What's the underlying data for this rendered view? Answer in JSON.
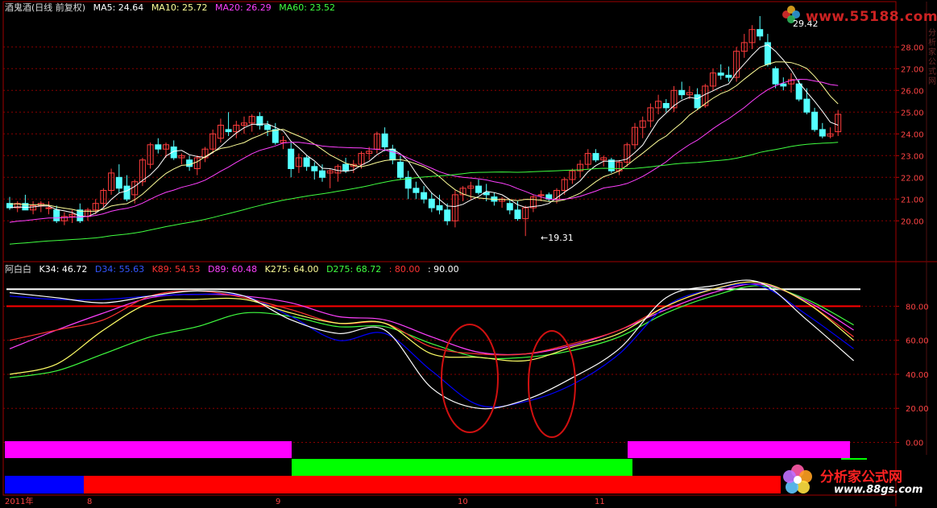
{
  "main_header": {
    "title": "酒鬼酒(日线 前复权)",
    "ma5": "MA5: 24.64",
    "ma10": "MA10: 25.72",
    "ma20": "MA20: 26.29",
    "ma60": "MA60: 23.52"
  },
  "sub_header": {
    "name": "阿白白",
    "k34": "K34: 46.72",
    "d34": "D34: 55.63",
    "k89": "K89: 54.53",
    "d89": "D89: 60.48",
    "k275": "K275: 64.00",
    "d275": "D275: 68.72",
    "l80": ": 80.00",
    "l90": ": 90.00"
  },
  "annotations": {
    "high": "29.42",
    "low": "←19.31"
  },
  "x_axis_labels": [
    "2011年",
    "8",
    "9",
    "10",
    "11"
  ],
  "watermarks": {
    "top": "www.55188.com",
    "bottom_title": "分析家公式网",
    "bottom_url": "www.88gs.com"
  },
  "right_strip_text": "分析家公式网",
  "colors": {
    "bg": "#000000",
    "up": "#ff3c3c",
    "down": "#54ffff",
    "grid": "#8b0000",
    "ma5": "#ffffff",
    "ma10": "#ffff99",
    "ma20": "#ff40ff",
    "ma60": "#40ff40",
    "bar_magenta": "#ff00ff",
    "bar_green": "#00ff00",
    "bar_blue": "#0000ff",
    "bar_red": "#ff0000"
  },
  "chart_data": [
    {
      "type": "candlestick",
      "title": "酒鬼酒(日线 前复权)",
      "y_ticks": [
        20.0,
        21.0,
        22.0,
        23.0,
        24.0,
        25.0,
        26.0,
        27.0,
        28.0
      ],
      "ylim": [
        19.0,
        29.8
      ],
      "candles": [
        [
          20.8,
          21.1,
          20.5,
          20.6
        ],
        [
          20.6,
          20.9,
          20.4,
          20.8
        ],
        [
          20.8,
          21.2,
          20.6,
          20.5
        ],
        [
          20.5,
          20.9,
          20.3,
          20.7
        ],
        [
          20.7,
          20.9,
          20.4,
          20.8
        ],
        [
          20.6,
          20.9,
          20.3,
          20.6
        ],
        [
          20.5,
          20.7,
          19.9,
          20.0
        ],
        [
          20.0,
          20.4,
          19.8,
          20.2
        ],
        [
          20.2,
          20.5,
          19.9,
          20.3
        ],
        [
          20.5,
          20.8,
          19.9,
          20.0
        ],
        [
          20.2,
          20.6,
          20.0,
          20.5
        ],
        [
          20.5,
          21.0,
          20.3,
          20.8
        ],
        [
          20.8,
          21.5,
          20.6,
          21.4
        ],
        [
          21.4,
          22.4,
          21.2,
          22.2
        ],
        [
          22.0,
          22.6,
          21.3,
          21.5
        ],
        [
          21.6,
          22.1,
          20.9,
          21.0
        ],
        [
          21.2,
          21.9,
          20.8,
          21.8
        ],
        [
          21.8,
          22.9,
          21.6,
          22.8
        ],
        [
          22.6,
          23.6,
          22.4,
          23.5
        ],
        [
          23.5,
          23.8,
          23.1,
          23.3
        ],
        [
          23.3,
          23.6,
          22.9,
          23.5
        ],
        [
          23.4,
          23.7,
          22.8,
          22.9
        ],
        [
          22.9,
          23.1,
          22.6,
          23.0
        ],
        [
          22.8,
          23.0,
          22.3,
          22.5
        ],
        [
          22.4,
          23.0,
          22.1,
          22.9
        ],
        [
          22.9,
          23.4,
          22.7,
          23.3
        ],
        [
          23.3,
          24.2,
          23.1,
          24.0
        ],
        [
          23.8,
          24.7,
          23.6,
          24.4
        ],
        [
          24.2,
          25.0,
          23.9,
          24.1
        ],
        [
          24.1,
          24.6,
          23.8,
          24.4
        ],
        [
          24.4,
          24.8,
          24.0,
          24.5
        ],
        [
          24.5,
          24.9,
          24.1,
          24.8
        ],
        [
          24.8,
          25.0,
          24.2,
          24.4
        ],
        [
          24.4,
          24.6,
          23.9,
          24.2
        ],
        [
          24.2,
          24.5,
          23.5,
          23.6
        ],
        [
          23.6,
          23.9,
          23.3,
          23.7
        ],
        [
          23.3,
          23.6,
          22.0,
          22.4
        ],
        [
          22.5,
          23.1,
          22.2,
          22.9
        ],
        [
          22.9,
          23.0,
          22.3,
          22.5
        ],
        [
          22.5,
          22.7,
          21.9,
          22.3
        ],
        [
          22.3,
          22.6,
          21.8,
          22.0
        ],
        [
          22.2,
          22.4,
          21.5,
          22.3
        ],
        [
          22.2,
          22.6,
          21.8,
          22.5
        ],
        [
          22.6,
          22.9,
          22.2,
          22.3
        ],
        [
          22.5,
          22.8,
          22.2,
          22.6
        ],
        [
          22.6,
          23.2,
          22.4,
          23.1
        ],
        [
          23.1,
          23.4,
          22.8,
          23.2
        ],
        [
          23.3,
          24.1,
          23.1,
          24.0
        ],
        [
          24.0,
          24.3,
          23.2,
          23.4
        ],
        [
          23.3,
          23.5,
          22.6,
          22.8
        ],
        [
          22.7,
          23.0,
          21.9,
          22.0
        ],
        [
          22.0,
          22.3,
          21.0,
          21.5
        ],
        [
          21.5,
          21.8,
          21.0,
          21.3
        ],
        [
          21.3,
          21.6,
          20.8,
          21.0
        ],
        [
          21.0,
          21.3,
          20.4,
          20.6
        ],
        [
          20.7,
          21.2,
          20.3,
          20.5
        ],
        [
          20.5,
          20.8,
          19.8,
          20.0
        ],
        [
          20.0,
          21.4,
          19.7,
          21.2
        ],
        [
          21.2,
          21.6,
          20.9,
          21.5
        ],
        [
          21.5,
          21.8,
          21.0,
          21.6
        ],
        [
          21.6,
          21.9,
          21.2,
          21.3
        ],
        [
          21.3,
          21.7,
          20.9,
          21.2
        ],
        [
          21.1,
          21.3,
          20.7,
          20.9
        ],
        [
          20.9,
          21.1,
          20.6,
          21.0
        ],
        [
          20.8,
          21.0,
          20.3,
          20.5
        ],
        [
          20.5,
          20.9,
          20.0,
          20.1
        ],
        [
          20.1,
          20.7,
          19.3,
          20.6
        ],
        [
          20.6,
          21.2,
          20.4,
          21.1
        ],
        [
          21.2,
          21.4,
          20.9,
          21.2
        ],
        [
          21.2,
          21.3,
          20.9,
          21.0
        ],
        [
          21.0,
          21.5,
          20.8,
          21.4
        ],
        [
          21.4,
          22.0,
          21.2,
          21.9
        ],
        [
          21.9,
          22.4,
          21.7,
          22.3
        ],
        [
          22.3,
          22.8,
          22.0,
          22.6
        ],
        [
          22.6,
          23.3,
          22.4,
          23.1
        ],
        [
          23.1,
          23.3,
          22.7,
          22.8
        ],
        [
          22.8,
          23.0,
          22.5,
          22.9
        ],
        [
          22.8,
          22.9,
          22.2,
          22.3
        ],
        [
          22.3,
          22.8,
          22.1,
          22.7
        ],
        [
          22.7,
          23.6,
          22.5,
          23.5
        ],
        [
          23.5,
          24.5,
          23.3,
          24.3
        ],
        [
          24.3,
          24.8,
          23.8,
          24.6
        ],
        [
          24.6,
          25.4,
          24.3,
          25.2
        ],
        [
          25.2,
          25.8,
          24.9,
          25.5
        ],
        [
          25.4,
          25.6,
          25.0,
          25.2
        ],
        [
          25.2,
          26.2,
          25.0,
          26.0
        ],
        [
          26.0,
          26.4,
          25.6,
          25.8
        ],
        [
          25.8,
          26.2,
          25.6,
          25.9
        ],
        [
          25.8,
          26.1,
          25.1,
          25.2
        ],
        [
          25.3,
          26.3,
          25.2,
          26.2
        ],
        [
          26.2,
          27.0,
          26.0,
          26.8
        ],
        [
          26.8,
          27.2,
          26.5,
          26.7
        ],
        [
          26.7,
          27.1,
          26.4,
          26.6
        ],
        [
          26.6,
          28.0,
          26.4,
          27.8
        ],
        [
          27.8,
          28.6,
          27.5,
          28.2
        ],
        [
          28.2,
          29.0,
          27.9,
          28.8
        ],
        [
          28.8,
          29.42,
          28.3,
          28.5
        ],
        [
          28.2,
          28.6,
          27.1,
          27.2
        ],
        [
          27.0,
          27.1,
          26.1,
          26.3
        ],
        [
          26.3,
          26.6,
          26.0,
          26.2
        ],
        [
          26.3,
          26.8,
          25.9,
          26.5
        ],
        [
          26.3,
          26.5,
          25.5,
          25.6
        ],
        [
          25.6,
          26.1,
          24.9,
          25.0
        ],
        [
          25.0,
          25.2,
          24.1,
          24.2
        ],
        [
          24.2,
          24.5,
          23.8,
          23.9
        ],
        [
          23.9,
          24.3,
          23.8,
          24.0
        ],
        [
          24.1,
          25.1,
          23.9,
          24.9
        ]
      ]
    },
    {
      "type": "line",
      "title": "阿白白",
      "y_ticks": [
        0,
        20,
        40,
        60,
        80
      ],
      "ylim": [
        -5,
        102
      ],
      "reference_lines": [
        {
          "name": "80.00",
          "value": 80,
          "color": "#ff0000"
        },
        {
          "name": "90.00",
          "value": 90,
          "color": "#ffffff"
        }
      ],
      "x_index": [
        0,
        6,
        12,
        18,
        24,
        30,
        36,
        42,
        48,
        54,
        60,
        66,
        72,
        78,
        84,
        90,
        96,
        102,
        108
      ],
      "series": [
        {
          "name": "K34",
          "color": "#ffffff",
          "values": [
            88,
            85,
            82,
            86,
            89,
            86,
            72,
            64,
            66,
            32,
            20,
            25,
            38,
            55,
            85,
            92,
            94,
            72,
            48
          ]
        },
        {
          "name": "D34",
          "color": "#0000ff",
          "values": [
            86,
            84,
            84,
            86,
            87,
            86,
            74,
            60,
            64,
            42,
            22,
            24,
            34,
            52,
            80,
            90,
            92,
            75,
            55
          ]
        },
        {
          "name": "K89",
          "color": "#ff3333",
          "values": [
            60,
            66,
            72,
            86,
            89,
            85,
            78,
            70,
            70,
            56,
            52,
            52,
            58,
            66,
            80,
            90,
            94,
            82,
            62
          ]
        },
        {
          "name": "D89",
          "color": "#ff40ff",
          "values": [
            55,
            66,
            76,
            85,
            87,
            86,
            82,
            74,
            72,
            62,
            53,
            52,
            57,
            66,
            78,
            88,
            93,
            83,
            66
          ]
        },
        {
          "name": "K275",
          "color": "#ffff66",
          "values": [
            40,
            46,
            66,
            82,
            84,
            84,
            76,
            70,
            70,
            52,
            50,
            48,
            56,
            64,
            80,
            90,
            94,
            82,
            60
          ]
        },
        {
          "name": "D275",
          "color": "#40ff40",
          "values": [
            38,
            42,
            52,
            62,
            68,
            76,
            74,
            68,
            68,
            58,
            50,
            50,
            54,
            62,
            76,
            86,
            92,
            84,
            69
          ]
        }
      ]
    }
  ],
  "color_bars": [
    {
      "name": "bar-row1-magenta-a",
      "color": "#ff00ff",
      "row": 1,
      "from": 0,
      "to": 58
    },
    {
      "name": "bar-row1-magenta-b",
      "color": "#ff00ff",
      "row": 1,
      "from": 126,
      "to": 171
    },
    {
      "name": "bar-row2-green",
      "color": "#00ff00",
      "row": 2,
      "from": 58,
      "to": 127
    },
    {
      "name": "bar-row3-blue",
      "color": "#0000ff",
      "row": 3,
      "from": 0,
      "to": 16
    },
    {
      "name": "bar-row3-red",
      "color": "#ff0000",
      "row": 3,
      "from": 16,
      "to": 157
    }
  ]
}
